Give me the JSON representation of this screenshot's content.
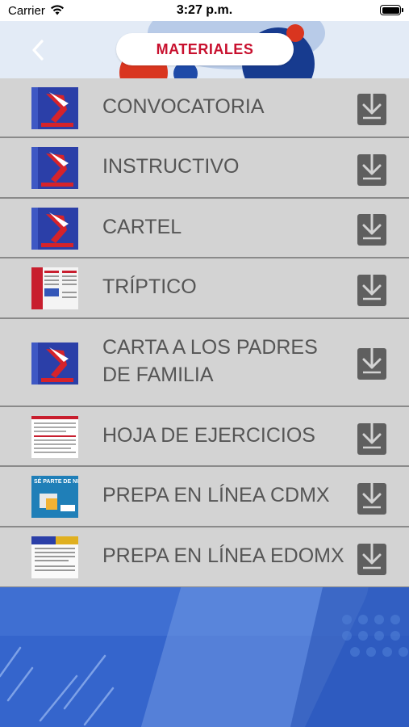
{
  "status_bar": {
    "carrier": "Carrier",
    "time": "3:27 p.m."
  },
  "header": {
    "title": "MATERIALES"
  },
  "items": [
    {
      "label": "CONVOCATORIA",
      "thumb": "blue-poster"
    },
    {
      "label": "INSTRUCTIVO",
      "thumb": "blue-poster"
    },
    {
      "label": "CARTEL",
      "thumb": "blue-poster"
    },
    {
      "label": "TRÍPTICO",
      "thumb": "triptych"
    },
    {
      "label": "CARTA A LOS PADRES DE FAMILIA",
      "thumb": "blue-poster"
    },
    {
      "label": "HOJA DE EJERCICIOS",
      "thumb": "worksheet"
    },
    {
      "label": "PREPA EN LÍNEA CDMX",
      "thumb": "cdmx-flyer",
      "thumb_text": "SÉ PARTE DE NUESTRA"
    },
    {
      "label": "PREPA EN LÍNEA EDOMX",
      "thumb": "edomx-doc"
    }
  ],
  "colors": {
    "title_red": "#c8102e",
    "row_bg": "#d3d3d3",
    "row_text": "#555555",
    "download_icon": "#5f5f5f",
    "background_blue": "#3565cc"
  },
  "icons": {
    "back": "chevron-left-icon",
    "download": "download-icon",
    "wifi": "wifi-icon",
    "battery": "battery-icon"
  }
}
